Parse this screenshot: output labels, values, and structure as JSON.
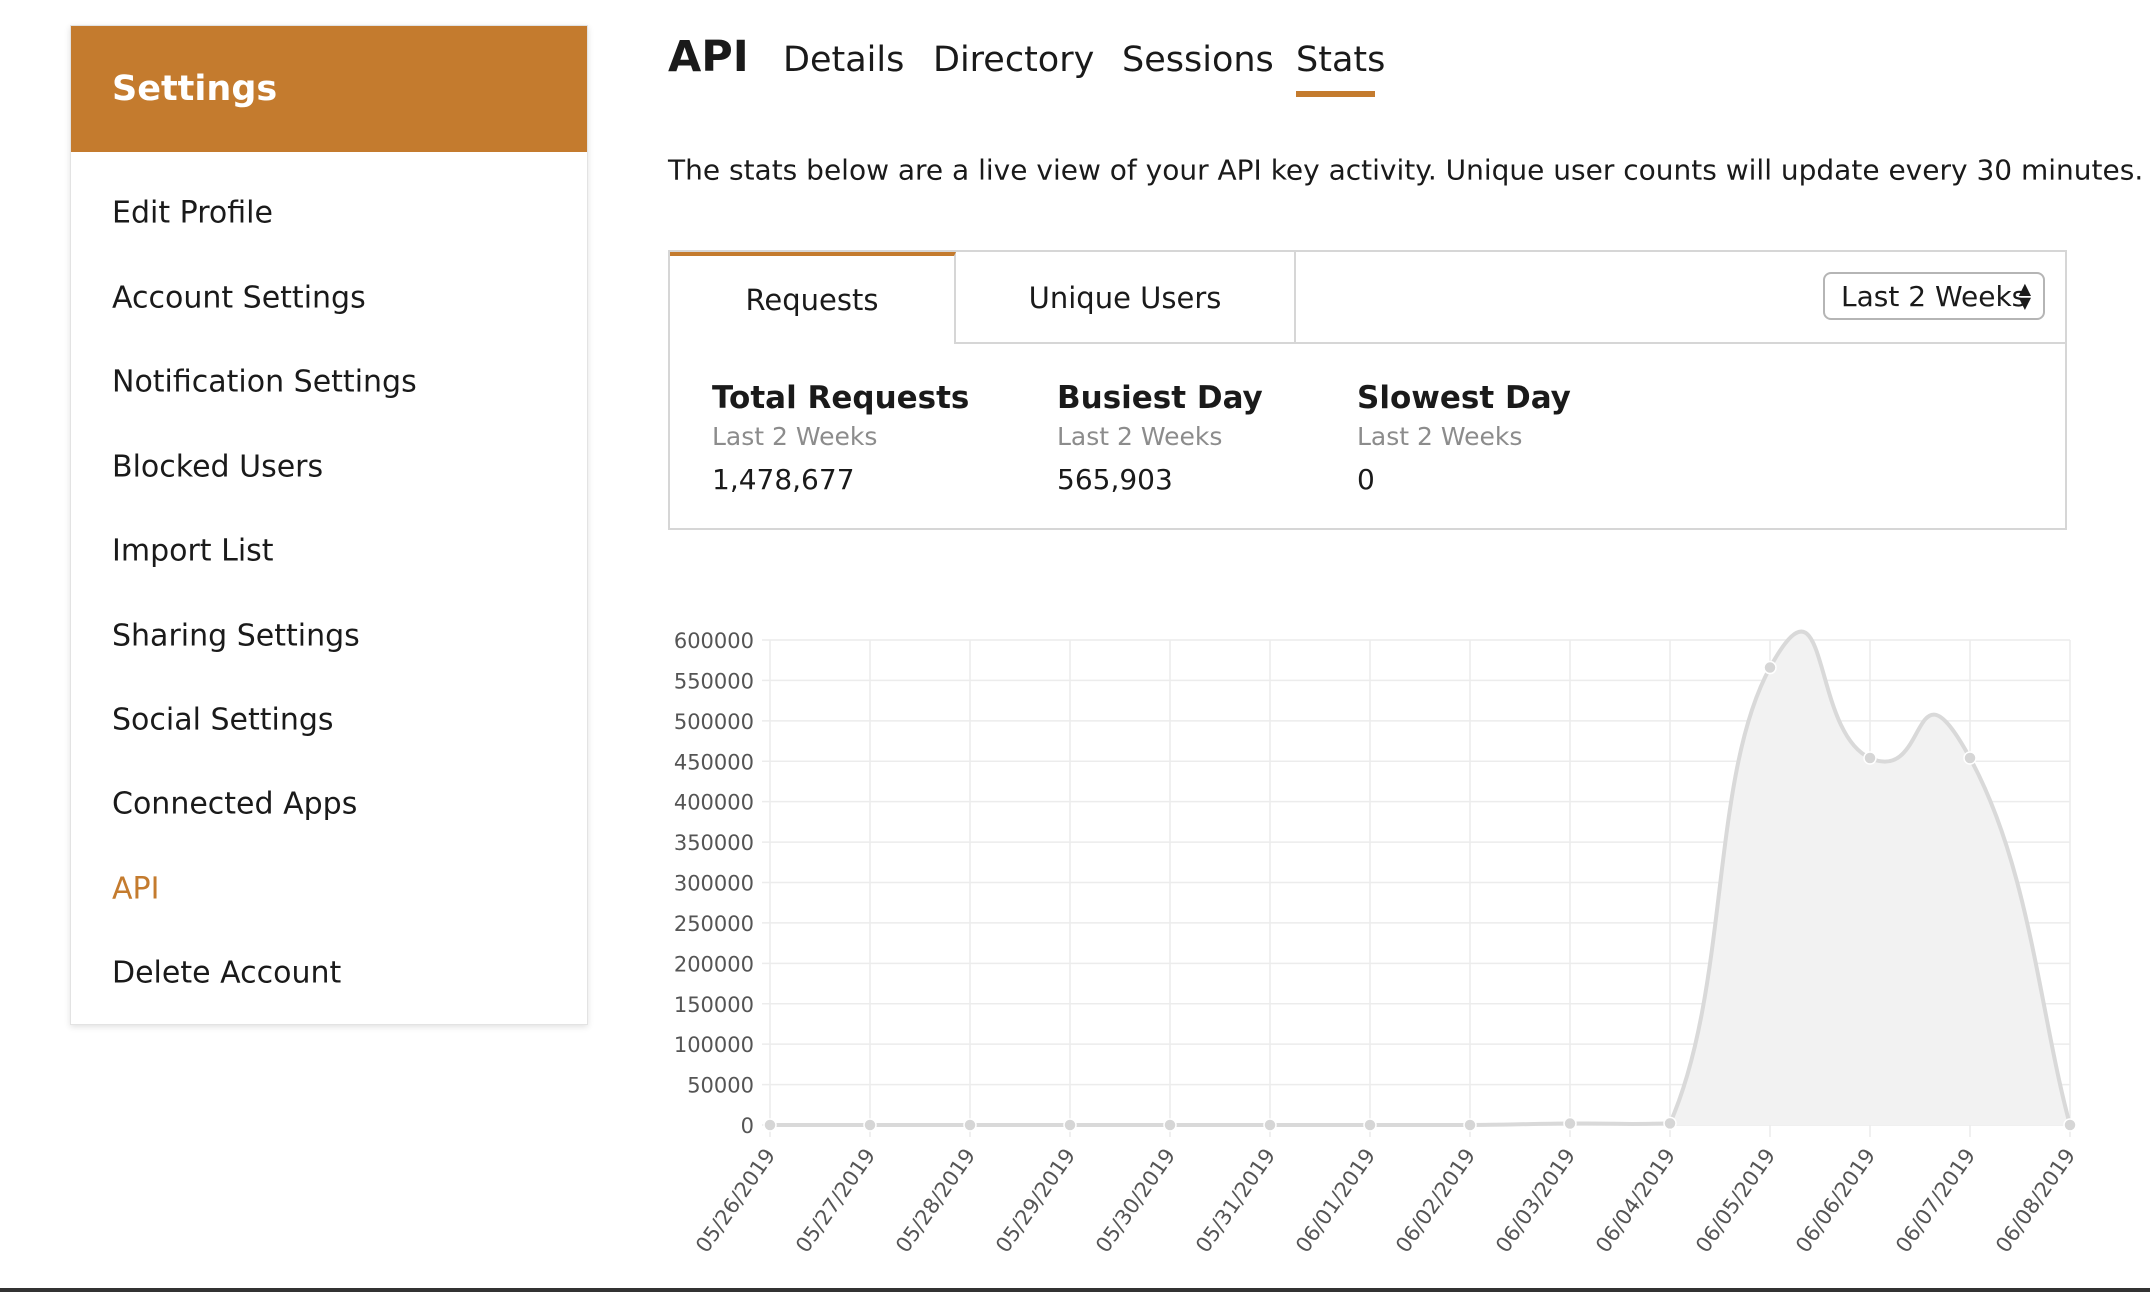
{
  "sidebar": {
    "title": "Settings",
    "items": [
      {
        "label": "Edit Profile",
        "active": false
      },
      {
        "label": "Account Settings",
        "active": false
      },
      {
        "label": "Notification Settings",
        "active": false
      },
      {
        "label": "Blocked Users",
        "active": false
      },
      {
        "label": "Import List",
        "active": false
      },
      {
        "label": "Sharing Settings",
        "active": false
      },
      {
        "label": "Social Settings",
        "active": false
      },
      {
        "label": "Connected Apps",
        "active": false
      },
      {
        "label": "API",
        "active": true
      },
      {
        "label": "Delete Account",
        "active": false
      }
    ]
  },
  "header": {
    "title": "API",
    "tabs": [
      {
        "label": "Details",
        "active": false
      },
      {
        "label": "Directory",
        "active": false
      },
      {
        "label": "Sessions",
        "active": false
      },
      {
        "label": "Stats",
        "active": true
      }
    ]
  },
  "intro": "The stats below are a live view of your API key activity. Unique user counts will update every 30 minutes.",
  "panel": {
    "tabs": [
      {
        "label": "Requests",
        "active": true
      },
      {
        "label": "Unique Users",
        "active": false
      }
    ],
    "range": {
      "selected": "Last 2 Weeks"
    },
    "stats": [
      {
        "title": "Total Requests",
        "sub": "Last 2 Weeks",
        "value": "1,478,677"
      },
      {
        "title": "Busiest Day",
        "sub": "Last 2 Weeks",
        "value": "565,903"
      },
      {
        "title": "Slowest Day",
        "sub": "Last 2 Weeks",
        "value": "0"
      }
    ]
  },
  "colors": {
    "accent": "#c47b2e",
    "series_line": "#d9d9d9",
    "series_fill": "#f2f2f2",
    "grid": "#ececec"
  },
  "chart_data": {
    "type": "area",
    "x": [
      "05/26/2019",
      "05/27/2019",
      "05/28/2019",
      "05/29/2019",
      "05/30/2019",
      "05/31/2019",
      "06/01/2019",
      "06/02/2019",
      "06/03/2019",
      "06/04/2019",
      "06/05/2019",
      "06/06/2019",
      "06/07/2019",
      "06/08/2019"
    ],
    "series": [
      {
        "values": [
          0,
          0,
          0,
          0,
          0,
          0,
          0,
          0,
          1800,
          2000,
          565903,
          454000,
          454000,
          0
        ]
      }
    ],
    "ylim": [
      0,
      600000
    ],
    "yticks": [
      "0",
      "50000",
      "100000",
      "150000",
      "200000",
      "250000",
      "300000",
      "350000",
      "400000",
      "450000",
      "500000",
      "550000",
      "600000"
    ],
    "grid": true,
    "legend": "none",
    "smooth": true
  }
}
